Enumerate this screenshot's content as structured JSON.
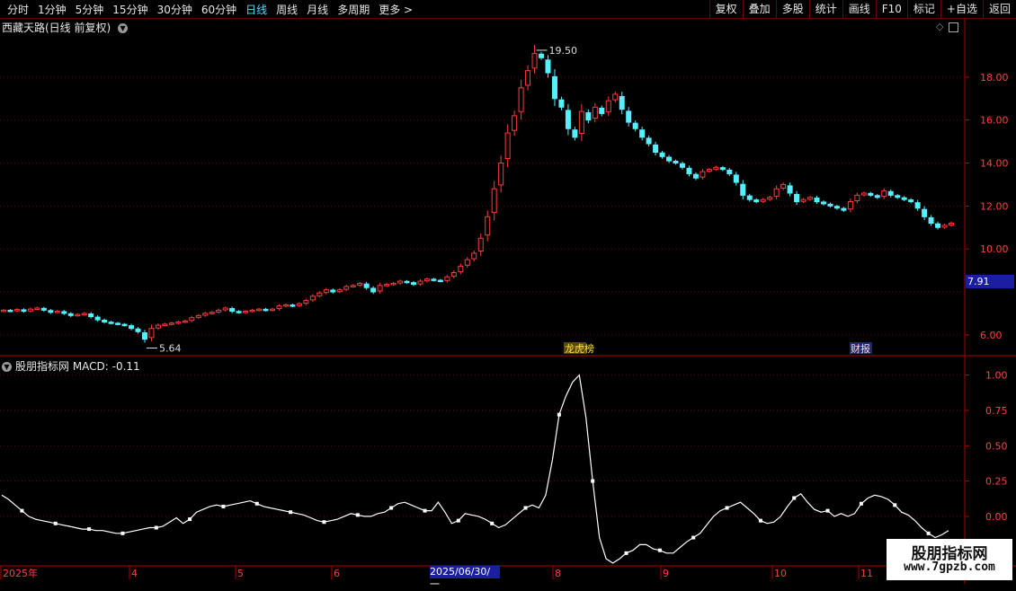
{
  "toolbar": {
    "periods": [
      "分时",
      "1分钟",
      "5分钟",
      "15分钟",
      "30分钟",
      "60分钟",
      "日线",
      "周线",
      "月线",
      "多周期",
      "更多 >"
    ],
    "active_period": "日线",
    "right_buttons": [
      "复权",
      "叠加",
      "多股",
      "统计",
      "画线",
      "F10",
      "标记",
      "+自选",
      "返回"
    ]
  },
  "main_chart": {
    "title": "西藏天路(日线 前复权)",
    "high_label": "19.50",
    "low_label": "5.64",
    "current_price": "7.91",
    "event_tags": [
      "龙虎榜",
      "财报"
    ],
    "y_ticks": [
      "18.00",
      "16.00",
      "14.00",
      "12.00",
      "10.00",
      "6.00"
    ]
  },
  "macd_chart": {
    "title": "股朋指标网 MACD: -0.11",
    "y_ticks": [
      "1.00",
      "0.75",
      "0.50",
      "0.25",
      "0.00"
    ]
  },
  "x_axis": {
    "labels": [
      "2025年",
      "4",
      "5",
      "6",
      "2025/06/30/一",
      "8",
      "9",
      "10",
      "11"
    ]
  },
  "watermark": {
    "line1": "股朋指标网",
    "line2": "www.7gpzb.com"
  },
  "colors": {
    "up": "#ff3b3b",
    "down": "#54f0ff",
    "grid": "#6b0000",
    "axis": "#b00000"
  },
  "chart_data": [
    {
      "type": "candlestick",
      "title": "西藏天路(日线 前复权)",
      "ylim": [
        5.2,
        20
      ],
      "y_ticks": [
        6,
        10,
        12,
        14,
        16,
        18
      ],
      "marked_high": 19.5,
      "marked_low": 5.64,
      "current": 7.91,
      "close_series": [
        7.15,
        7.12,
        7.18,
        7.1,
        7.2,
        7.25,
        7.15,
        7.05,
        7.1,
        7.0,
        6.9,
        6.95,
        7.0,
        6.85,
        6.7,
        6.6,
        6.55,
        6.5,
        6.45,
        6.3,
        6.15,
        5.8,
        6.3,
        6.45,
        6.5,
        6.55,
        6.6,
        6.65,
        6.8,
        6.9,
        7.0,
        7.05,
        7.15,
        7.25,
        7.1,
        7.05,
        7.1,
        7.15,
        7.2,
        7.15,
        7.2,
        7.35,
        7.4,
        7.35,
        7.45,
        7.6,
        7.8,
        7.95,
        8.1,
        8.0,
        8.1,
        8.25,
        8.3,
        8.4,
        8.2,
        8.0,
        8.3,
        8.35,
        8.4,
        8.5,
        8.45,
        8.35,
        8.5,
        8.6,
        8.55,
        8.5,
        8.7,
        8.9,
        9.2,
        9.5,
        9.8,
        10.5,
        11.5,
        12.8,
        14.0,
        15.4,
        16.2,
        17.5,
        18.3,
        19.1,
        18.9,
        18.2,
        17.0,
        16.6,
        15.6,
        15.2,
        16.4,
        16.0,
        16.6,
        16.3,
        16.9,
        17.2,
        16.5,
        15.9,
        15.6,
        15.2,
        14.9,
        14.5,
        14.3,
        14.1,
        14.0,
        13.8,
        13.5,
        13.3,
        13.6,
        13.7,
        13.8,
        13.7,
        13.5,
        13.1,
        12.5,
        12.3,
        12.2,
        12.3,
        12.4,
        12.8,
        13.0,
        12.6,
        12.2,
        12.3,
        12.4,
        12.2,
        12.1,
        12.0,
        11.9,
        11.8,
        12.2,
        12.5,
        12.6,
        12.5,
        12.4,
        12.7,
        12.5,
        12.4,
        12.3,
        12.2,
        11.9,
        11.5,
        11.2,
        11.0,
        11.1,
        11.2
      ]
    },
    {
      "type": "line",
      "title": "MACD",
      "ylim": [
        -0.35,
        1.08
      ],
      "y_ticks": [
        0,
        0.25,
        0.5,
        0.75,
        1.0
      ],
      "current": -0.11,
      "values": [
        0.15,
        0.12,
        0.08,
        0.04,
        0.0,
        -0.02,
        -0.03,
        -0.04,
        -0.05,
        -0.06,
        -0.07,
        -0.08,
        -0.09,
        -0.09,
        -0.1,
        -0.1,
        -0.11,
        -0.12,
        -0.12,
        -0.11,
        -0.1,
        -0.09,
        -0.08,
        -0.08,
        -0.07,
        -0.04,
        -0.01,
        -0.05,
        -0.02,
        0.03,
        0.05,
        0.07,
        0.08,
        0.07,
        0.08,
        0.09,
        0.1,
        0.11,
        0.09,
        0.07,
        0.06,
        0.05,
        0.04,
        0.03,
        0.02,
        0.01,
        -0.01,
        -0.03,
        -0.04,
        -0.03,
        -0.02,
        0.0,
        0.02,
        0.01,
        0.0,
        0.0,
        0.02,
        0.03,
        0.06,
        0.09,
        0.1,
        0.08,
        0.06,
        0.04,
        0.04,
        0.1,
        0.03,
        -0.05,
        -0.03,
        0.02,
        0.01,
        0.0,
        -0.02,
        -0.05,
        -0.08,
        -0.06,
        -0.02,
        0.02,
        0.06,
        0.08,
        0.06,
        0.15,
        0.4,
        0.72,
        0.85,
        0.95,
        1.0,
        0.7,
        0.25,
        -0.15,
        -0.3,
        -0.33,
        -0.3,
        -0.26,
        -0.24,
        -0.2,
        -0.2,
        -0.23,
        -0.24,
        -0.26,
        -0.26,
        -0.22,
        -0.18,
        -0.15,
        -0.12,
        -0.06,
        0.0,
        0.04,
        0.06,
        0.08,
        0.1,
        0.06,
        0.02,
        -0.03,
        -0.05,
        -0.04,
        0.0,
        0.07,
        0.13,
        0.16,
        0.1,
        0.05,
        0.03,
        0.04,
        0.0,
        0.02,
        0.0,
        0.02,
        0.09,
        0.13,
        0.15,
        0.14,
        0.12,
        0.08,
        0.03,
        0.01,
        -0.03,
        -0.08,
        -0.12,
        -0.15,
        -0.13,
        -0.1
      ]
    }
  ]
}
